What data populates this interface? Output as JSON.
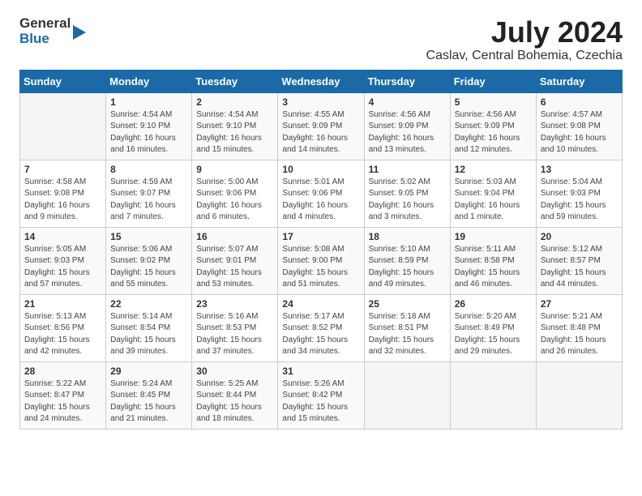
{
  "header": {
    "logo_general": "General",
    "logo_blue": "Blue",
    "month_year": "July 2024",
    "location": "Caslav, Central Bohemia, Czechia"
  },
  "weekdays": [
    "Sunday",
    "Monday",
    "Tuesday",
    "Wednesday",
    "Thursday",
    "Friday",
    "Saturday"
  ],
  "weeks": [
    [
      {
        "day": "",
        "info": ""
      },
      {
        "day": "1",
        "info": "Sunrise: 4:54 AM\nSunset: 9:10 PM\nDaylight: 16 hours\nand 16 minutes."
      },
      {
        "day": "2",
        "info": "Sunrise: 4:54 AM\nSunset: 9:10 PM\nDaylight: 16 hours\nand 15 minutes."
      },
      {
        "day": "3",
        "info": "Sunrise: 4:55 AM\nSunset: 9:09 PM\nDaylight: 16 hours\nand 14 minutes."
      },
      {
        "day": "4",
        "info": "Sunrise: 4:56 AM\nSunset: 9:09 PM\nDaylight: 16 hours\nand 13 minutes."
      },
      {
        "day": "5",
        "info": "Sunrise: 4:56 AM\nSunset: 9:09 PM\nDaylight: 16 hours\nand 12 minutes."
      },
      {
        "day": "6",
        "info": "Sunrise: 4:57 AM\nSunset: 9:08 PM\nDaylight: 16 hours\nand 10 minutes."
      }
    ],
    [
      {
        "day": "7",
        "info": "Sunrise: 4:58 AM\nSunset: 9:08 PM\nDaylight: 16 hours\nand 9 minutes."
      },
      {
        "day": "8",
        "info": "Sunrise: 4:59 AM\nSunset: 9:07 PM\nDaylight: 16 hours\nand 7 minutes."
      },
      {
        "day": "9",
        "info": "Sunrise: 5:00 AM\nSunset: 9:06 PM\nDaylight: 16 hours\nand 6 minutes."
      },
      {
        "day": "10",
        "info": "Sunrise: 5:01 AM\nSunset: 9:06 PM\nDaylight: 16 hours\nand 4 minutes."
      },
      {
        "day": "11",
        "info": "Sunrise: 5:02 AM\nSunset: 9:05 PM\nDaylight: 16 hours\nand 3 minutes."
      },
      {
        "day": "12",
        "info": "Sunrise: 5:03 AM\nSunset: 9:04 PM\nDaylight: 16 hours\nand 1 minute."
      },
      {
        "day": "13",
        "info": "Sunrise: 5:04 AM\nSunset: 9:03 PM\nDaylight: 15 hours\nand 59 minutes."
      }
    ],
    [
      {
        "day": "14",
        "info": "Sunrise: 5:05 AM\nSunset: 9:03 PM\nDaylight: 15 hours\nand 57 minutes."
      },
      {
        "day": "15",
        "info": "Sunrise: 5:06 AM\nSunset: 9:02 PM\nDaylight: 15 hours\nand 55 minutes."
      },
      {
        "day": "16",
        "info": "Sunrise: 5:07 AM\nSunset: 9:01 PM\nDaylight: 15 hours\nand 53 minutes."
      },
      {
        "day": "17",
        "info": "Sunrise: 5:08 AM\nSunset: 9:00 PM\nDaylight: 15 hours\nand 51 minutes."
      },
      {
        "day": "18",
        "info": "Sunrise: 5:10 AM\nSunset: 8:59 PM\nDaylight: 15 hours\nand 49 minutes."
      },
      {
        "day": "19",
        "info": "Sunrise: 5:11 AM\nSunset: 8:58 PM\nDaylight: 15 hours\nand 46 minutes."
      },
      {
        "day": "20",
        "info": "Sunrise: 5:12 AM\nSunset: 8:57 PM\nDaylight: 15 hours\nand 44 minutes."
      }
    ],
    [
      {
        "day": "21",
        "info": "Sunrise: 5:13 AM\nSunset: 8:56 PM\nDaylight: 15 hours\nand 42 minutes."
      },
      {
        "day": "22",
        "info": "Sunrise: 5:14 AM\nSunset: 8:54 PM\nDaylight: 15 hours\nand 39 minutes."
      },
      {
        "day": "23",
        "info": "Sunrise: 5:16 AM\nSunset: 8:53 PM\nDaylight: 15 hours\nand 37 minutes."
      },
      {
        "day": "24",
        "info": "Sunrise: 5:17 AM\nSunset: 8:52 PM\nDaylight: 15 hours\nand 34 minutes."
      },
      {
        "day": "25",
        "info": "Sunrise: 5:18 AM\nSunset: 8:51 PM\nDaylight: 15 hours\nand 32 minutes."
      },
      {
        "day": "26",
        "info": "Sunrise: 5:20 AM\nSunset: 8:49 PM\nDaylight: 15 hours\nand 29 minutes."
      },
      {
        "day": "27",
        "info": "Sunrise: 5:21 AM\nSunset: 8:48 PM\nDaylight: 15 hours\nand 26 minutes."
      }
    ],
    [
      {
        "day": "28",
        "info": "Sunrise: 5:22 AM\nSunset: 8:47 PM\nDaylight: 15 hours\nand 24 minutes."
      },
      {
        "day": "29",
        "info": "Sunrise: 5:24 AM\nSunset: 8:45 PM\nDaylight: 15 hours\nand 21 minutes."
      },
      {
        "day": "30",
        "info": "Sunrise: 5:25 AM\nSunset: 8:44 PM\nDaylight: 15 hours\nand 18 minutes."
      },
      {
        "day": "31",
        "info": "Sunrise: 5:26 AM\nSunset: 8:42 PM\nDaylight: 15 hours\nand 15 minutes."
      },
      {
        "day": "",
        "info": ""
      },
      {
        "day": "",
        "info": ""
      },
      {
        "day": "",
        "info": ""
      }
    ]
  ]
}
